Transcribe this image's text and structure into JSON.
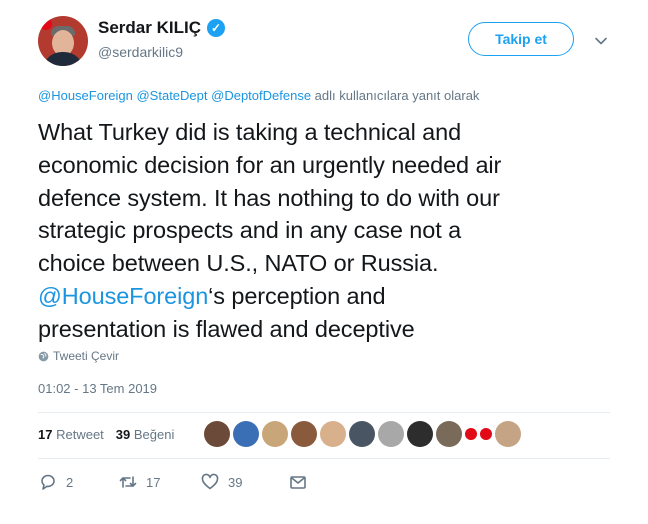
{
  "author": {
    "name": "Serdar KILIÇ",
    "handle": "@serdarkilic9",
    "verified_icon": "verified-badge-icon"
  },
  "follow_label": "Takip et",
  "reply_to": {
    "mentions": [
      "@HouseForeign",
      "@StateDept",
      "@DeptofDefense"
    ],
    "suffix": "adlı kullanıcılara yanıt olarak"
  },
  "tweet": {
    "lines": [
      "What Turkey did is taking a technical and",
      "economic decision for an urgently needed air",
      "defence system. It has nothing to do with our",
      "strategic prospects and in any case not a",
      "choice between U.S., NATO or Russia."
    ],
    "mention": "@HouseForeign",
    "mention_tail": "‘s perception and",
    "last_line": "presentation is flawed and deceptive"
  },
  "translate_label": "Tweeti Çevir",
  "timestamp": "01:02 - 13 Tem 2019",
  "stats": {
    "retweet_count": "17",
    "retweet_label": "Retweet",
    "like_count": "39",
    "like_label": "Beğeni"
  },
  "actions": {
    "reply_count": "2",
    "retweet_count": "17",
    "like_count": "39"
  },
  "liker_colors": [
    "#6b4a3a",
    "#3b6fb5",
    "#c9a57a",
    "#8a5a3c",
    "#d9b08c",
    "#4a5563",
    "#a8a8a8",
    "#2d2d2d",
    "#7a6a5a",
    "#e30a17",
    "#e30a17",
    "#c4a484"
  ],
  "colors": {
    "accent": "#1da1f2",
    "link": "#1b95e0",
    "muted": "#657786",
    "text": "#14171a"
  }
}
